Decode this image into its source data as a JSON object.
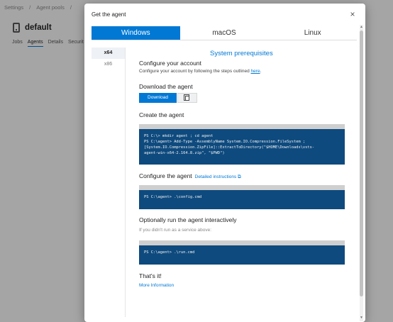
{
  "background": {
    "breadcrumb": [
      "Settings",
      "/",
      "Agent pools",
      "/"
    ],
    "pool_title": "default",
    "tabs": [
      "Jobs",
      "Agents",
      "Details",
      "Securit"
    ]
  },
  "dialog": {
    "title": "Get the agent",
    "close_icon": "×",
    "os_tabs": [
      "Windows",
      "macOS",
      "Linux"
    ],
    "arch": [
      "x64",
      "x86"
    ],
    "prereq_link": "System prerequisites",
    "configure_account": {
      "heading": "Configure your account",
      "text": "Configure your account by following the steps outlined ",
      "link": "here",
      "suffix": "."
    },
    "download": {
      "heading": "Download the agent",
      "button": "Download"
    },
    "create": {
      "heading": "Create the agent",
      "code": "PS C:\\> mkdir agent ; cd agent\nPS C:\\agent> Add-Type -AssemblyName System.IO.Compression.FileSystem ;\n[System.IO.Compression.ZipFile]::ExtractToDirectory(\"$HOME\\Downloads\\vsts-\nagent-win-x64-2.164.8.zip\", \"$PWD\")"
    },
    "configure": {
      "heading": "Configure the agent",
      "link": "Detailed instructions ⧉",
      "code": "PS C:\\agent> .\\config.cmd"
    },
    "run": {
      "heading": "Optionally run the agent interactively",
      "note": "If you didn't run as a service above:",
      "code": "PS C:\\agent> .\\run.cmd"
    },
    "done": "That's it!",
    "more_link": "More Information"
  },
  "colors": {
    "accent": "#0078d4",
    "code_bg": "#0e4a7e"
  }
}
